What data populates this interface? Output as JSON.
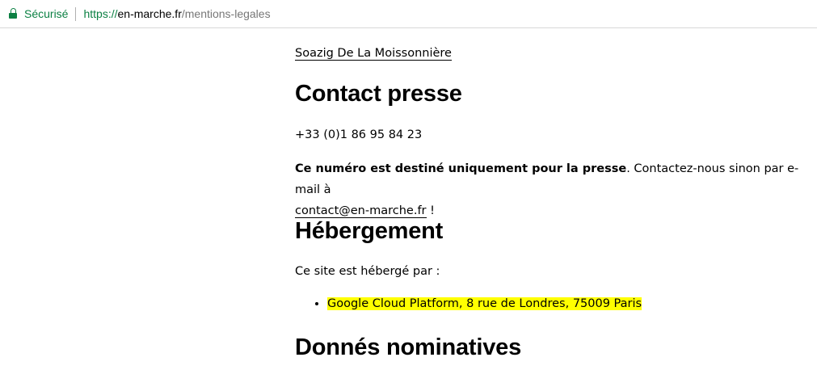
{
  "browser": {
    "secure_label": "Sécurisé",
    "url_scheme": "https://",
    "url_host": "en-marche.fr",
    "url_path": "/mentions-legales"
  },
  "content": {
    "author_link": "Soazig De La Moissonnière",
    "contact_heading": "Contact presse",
    "phone": "+33 (0)1 86 95 84 23",
    "notice_bold": "Ce numéro est destiné uniquement pour la presse",
    "notice_rest": ". Contactez-nous sinon par e-mail à",
    "email_link": "contact@en-marche.fr",
    "notice_end": " !",
    "hosting_heading": "Hébergement",
    "hosting_intro": "Ce site est hébergé par :",
    "hosting_items": [
      "Google Cloud Platform, 8 rue de Londres, 75009 Paris"
    ],
    "data_heading": "Donnés nominatives"
  },
  "colors": {
    "secure_green": "#0b8043",
    "highlight": "#ffff00"
  },
  "icons": {
    "secure": "lock-icon"
  }
}
